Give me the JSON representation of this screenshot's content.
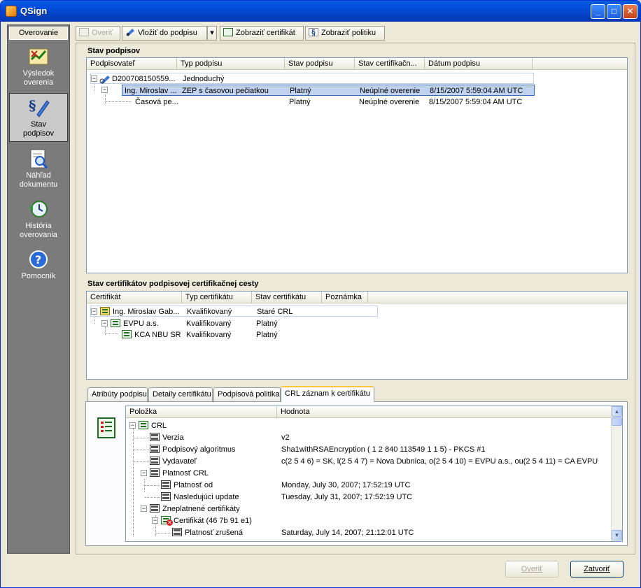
{
  "window": {
    "title": "QSign",
    "controls": {
      "minimize": "_",
      "maximize": "□",
      "close": "✕"
    }
  },
  "leftnav": {
    "header": "Overovanie",
    "items": [
      {
        "label_line1": "Výsledok",
        "label_line2": "overenia",
        "icon": "verification-result-icon"
      },
      {
        "label_line1": "Stav",
        "label_line2": "podpisov",
        "icon": "signature-status-icon",
        "active": true
      },
      {
        "label_line1": "Náhľad",
        "label_line2": "dokumentu",
        "icon": "document-preview-icon"
      },
      {
        "label_line1": "História",
        "label_line2": "overovania",
        "icon": "verification-history-icon"
      },
      {
        "label_line1": "Pomocník",
        "label_line2": "",
        "icon": "help-icon"
      }
    ]
  },
  "toolbar": {
    "verify_label": "Overiť",
    "insert_label": "Vložiť do podpisu",
    "dropdown_arrow": "▾",
    "show_cert_label": "Zobraziť certifikát",
    "show_policy_label": "Zobraziť politiku"
  },
  "signatures": {
    "section_title": "Stav podpisov",
    "columns": [
      "Podpisovateľ",
      "Typ podpisu",
      "Stav podpisu",
      "Stav certifikačn...",
      "Dátum podpisu"
    ],
    "rows": [
      {
        "signer": "D200708150559...",
        "type": "Jednoduchý",
        "status": "",
        "cert_status": "",
        "date": ""
      },
      {
        "signer": "Ing. Miroslav ...",
        "type": "ZEP s časovou pečiatkou",
        "status": "Platný",
        "cert_status": "Neúplné overenie",
        "date": "8/15/2007 5:59:04 AM UTC"
      },
      {
        "signer": "Časová pe...",
        "type": "",
        "status": "Platný",
        "cert_status": "Neúplné overenie",
        "date": "8/15/2007 5:59:04 AM UTC"
      }
    ]
  },
  "certificates": {
    "section_title": "Stav certifikátov podpisovej certifikačnej cesty",
    "columns": [
      "Certifikát",
      "Typ certifikátu",
      "Stav certifikátu",
      "Poznámka"
    ],
    "rows": [
      {
        "name": "Ing. Miroslav Gab...",
        "type": "Kvalifikovaný",
        "status": "Staré CRL",
        "note": ""
      },
      {
        "name": "EVPU a.s.",
        "type": "Kvalifikovaný",
        "status": "Platný",
        "note": ""
      },
      {
        "name": "KCA NBU SR",
        "type": "Kvalifikovaný",
        "status": "Platný",
        "note": ""
      }
    ]
  },
  "tabs": [
    "Atribúty podpisu",
    "Detaily certifikátu",
    "Podpisová politika",
    "CRL záznam k certifikátu"
  ],
  "crl": {
    "columns": [
      "Položka",
      "Hodnota"
    ],
    "rows": [
      {
        "item": "CRL",
        "value": ""
      },
      {
        "item": "Verzia",
        "value": "v2"
      },
      {
        "item": "Podpisový algoritmus",
        "value": "Sha1withRSAEncryption ( 1 2 840 113549 1 1 5) - PKCS #1"
      },
      {
        "item": "Vydavateľ",
        "value": "c(2 5 4 6) = SK,  l(2 5 4 7) = Nova Dubnica,  o(2 5 4 10) = EVPU a.s.,  ou(2 5 4 11) = CA EVPU"
      },
      {
        "item": "Platnosť CRL",
        "value": ""
      },
      {
        "item": "Platnosť od",
        "value": "Monday, July 30, 2007; 17:52:19 UTC"
      },
      {
        "item": "Nasledujúci update",
        "value": "Tuesday, July 31, 2007; 17:52:19 UTC"
      },
      {
        "item": "Zneplatnené certifikáty",
        "value": ""
      },
      {
        "item": "Certifikát (46 7b 91 e1)",
        "value": ""
      },
      {
        "item": "Platnosť zrušená",
        "value": "Saturday, July 14, 2007; 21:12:01 UTC"
      }
    ]
  },
  "buttons": {
    "verify_label": "Overiť",
    "close_label": "Zatvoriť"
  }
}
